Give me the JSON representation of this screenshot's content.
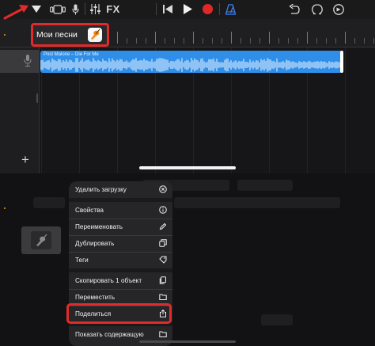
{
  "toolbar": {
    "fx_label": "FX",
    "icons": [
      "my-songs-dropdown",
      "browser-view",
      "microphone",
      "track-controls",
      "fx",
      "rewind",
      "play",
      "record",
      "metronome",
      "undo",
      "loop",
      "settings"
    ]
  },
  "my_songs": {
    "label": "Мои песни"
  },
  "track": {
    "region_name": "Post Malone – Die For Me"
  },
  "context_menu": {
    "items": [
      {
        "label": "Удалить загрузку",
        "icon": "x-circle-icon"
      },
      {
        "label": "Свойства",
        "icon": "info-icon"
      },
      {
        "label": "Переименовать",
        "icon": "pencil-icon"
      },
      {
        "label": "Дублировать",
        "icon": "duplicate-icon"
      },
      {
        "label": "Теги",
        "icon": "tag-icon"
      },
      {
        "label": "Скопировать 1 объект",
        "icon": "copy-icon"
      },
      {
        "label": "Переместить",
        "icon": "folder-icon"
      },
      {
        "label": "Поделиться",
        "icon": "share-icon"
      },
      {
        "label": "Показать содержащую",
        "icon": "folder-icon"
      }
    ]
  },
  "colors": {
    "accent_red": "#e12b2b",
    "region_blue": "#2f8fe8",
    "record_red": "#e02828",
    "metronome_blue": "#3a82f7"
  }
}
